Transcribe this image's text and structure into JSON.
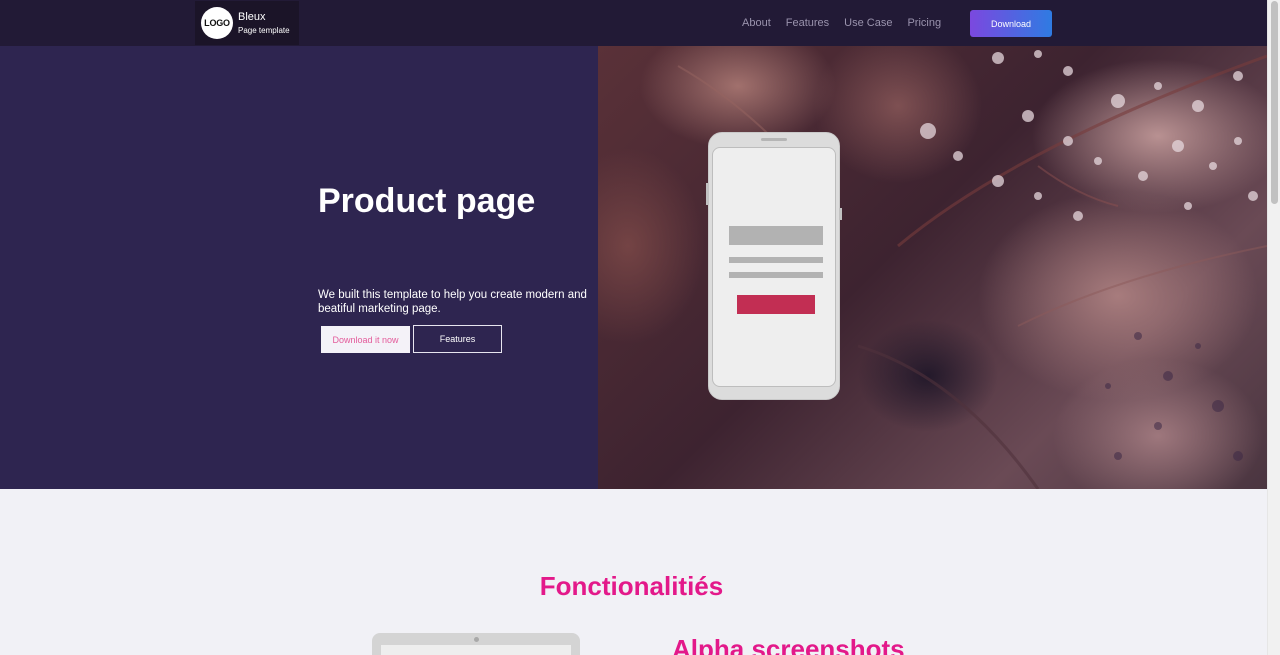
{
  "navbar": {
    "logo_text": "LOGO",
    "brand_name": "Bleux",
    "brand_sub": "Page template",
    "links": [
      "About",
      "Features",
      "Use Case",
      "Pricing"
    ],
    "download_label": "Download"
  },
  "hero": {
    "title": "Product page",
    "description": "We built this template to help you create modern and beatiful marketing page.",
    "primary_button": "Download it now",
    "secondary_button": "Features"
  },
  "features": {
    "title": "Fonctionalitiés",
    "subtitle": "Alpha screenshots"
  },
  "colors": {
    "navbar_bg": "#221a36",
    "hero_bg": "#2e2550",
    "accent_pink": "#e3198a",
    "download_gradient_start": "#7b48df",
    "download_gradient_end": "#2f7be2",
    "phone_cta": "#c22e53"
  },
  "icons": {
    "phone_mockup": "smartphone-mockup",
    "laptop_mockup": "laptop-mockup"
  }
}
